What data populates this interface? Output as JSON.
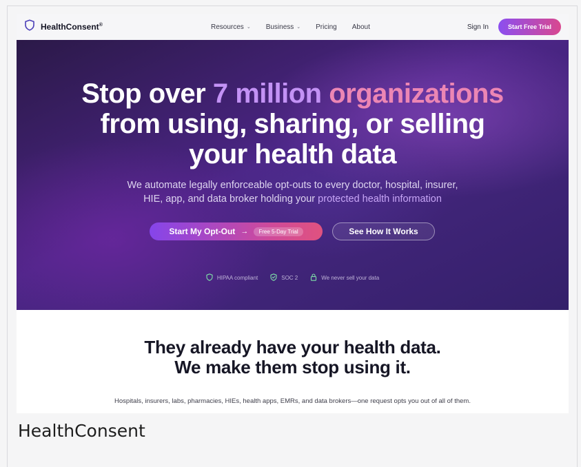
{
  "nav": {
    "brand": "HealthConsent",
    "brand_mark": "®",
    "links": [
      {
        "label": "Resources",
        "has_dropdown": true
      },
      {
        "label": "Business",
        "has_dropdown": true
      },
      {
        "label": "Pricing",
        "has_dropdown": false
      },
      {
        "label": "About",
        "has_dropdown": false
      }
    ],
    "sign_in": "Sign In",
    "start_trial": "Start Free Trial"
  },
  "hero": {
    "title_part1": "Stop over ",
    "title_highlight1": "7 million",
    "title_space": " ",
    "title_highlight2": "organizations",
    "title_line2": "from using, sharing, or selling",
    "title_line3": "your health data",
    "subtitle_line1": "We automate legally enforceable opt-outs to every doctor, hospital, insurer,",
    "subtitle_line2_part1": "HIE, app, and data broker holding your ",
    "subtitle_line2_highlight": "protected health information",
    "cta_primary": "Start My Opt-Out",
    "cta_primary_arrow": "→",
    "cta_pill": "Free 5-Day Trial",
    "cta_secondary": "See How It Works",
    "badges": [
      {
        "icon": "shield-icon",
        "label": "HIPAA compliant"
      },
      {
        "icon": "check-shield-icon",
        "label": "SOC 2"
      },
      {
        "icon": "lock-icon",
        "label": "We never sell your data"
      }
    ]
  },
  "section": {
    "title_line1": "They already have your health data.",
    "title_line2": "We make them stop using it.",
    "subtitle": "Hospitals, insurers, labs, pharmacies, HIEs, health apps, EMRs, and data brokers—one request opts you out of all of them."
  },
  "page_label": "HealthConsent",
  "colors": {
    "accent_purple": "#8b4ef0",
    "accent_pink": "#d9488f",
    "hero_bg": "#4b2585",
    "badge_icon_green": "#7ee0a8"
  }
}
